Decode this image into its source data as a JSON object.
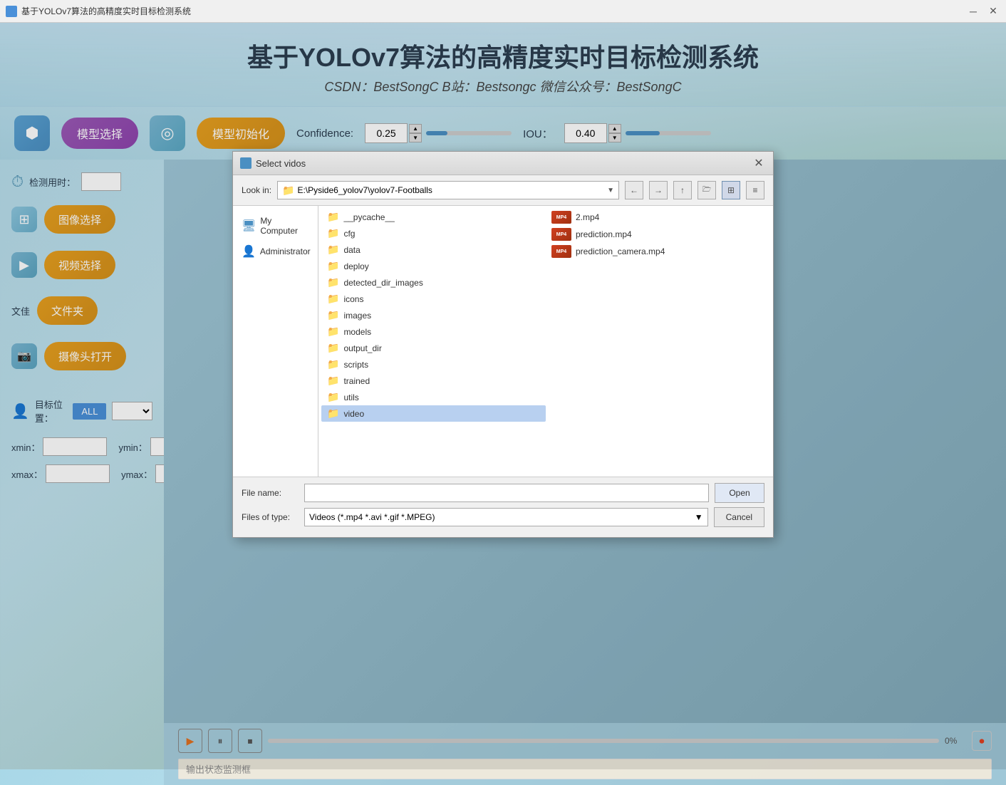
{
  "window": {
    "title": "基于YOLOv7算法的高精度实时目标检测系统",
    "minimize_label": "─",
    "close_label": "✕"
  },
  "header": {
    "title": "基于YOLOv7算法的高精度实时目标检测系统",
    "subtitle": "CSDN：BestSongC   B站：Bestsongc   微信公众号：BestSongC"
  },
  "toolbar": {
    "cube_icon": "⬡",
    "model_select_label": "模型选择",
    "target_icon": "◎",
    "model_init_label": "模型初始化",
    "confidence_label": "Confidence:",
    "confidence_value": "0.25",
    "iou_label": "IOU：",
    "iou_value": "0.40"
  },
  "sidebar": {
    "detect_time_label": "检测用时：",
    "image_select_label": "图像选择",
    "video_select_label": "视频选择",
    "folder_label": "文件夹",
    "camera_label": "摄像头打开",
    "target_pos_label": "目标位置：",
    "all_label": "ALL",
    "xmin_label": "xmin：",
    "ymin_label": "ymin：",
    "xmax_label": "xmax：",
    "ymax_label": "ymax："
  },
  "playback": {
    "progress_text": "0%",
    "status_text": "输出状态监测框"
  },
  "dialog": {
    "title": "Select vidos",
    "look_in_label": "Look in:",
    "look_in_path": "E:\\Pyside6_yolov7\\yolov7-Footballs",
    "my_computer_label": "My Computer",
    "administrator_label": "Administrator",
    "file_name_label": "File name:",
    "file_name_value": "",
    "files_of_type_label": "Files of type:",
    "files_of_type_value": "Videos (*.mp4 *.avi *.gif *.MPEG)",
    "open_label": "Open",
    "cancel_label": "Cancel",
    "folders": [
      "__pycache__",
      "cfg",
      "data",
      "deploy",
      "detected_dir_images",
      "icons",
      "images",
      "models",
      "output_dir",
      "scripts",
      "trained",
      "utils",
      "video"
    ],
    "files": [
      {
        "name": "2.mp4",
        "type": "video"
      },
      {
        "name": "prediction.mp4",
        "type": "video"
      },
      {
        "name": "prediction_camera.mp4",
        "type": "video"
      }
    ],
    "selected_folder": "video"
  }
}
